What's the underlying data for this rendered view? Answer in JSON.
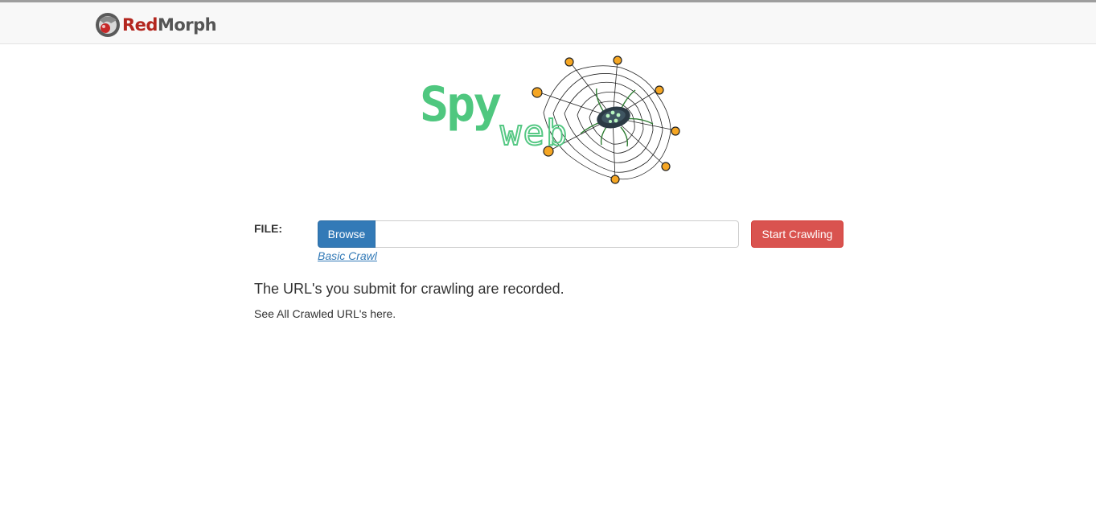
{
  "navbar": {
    "brand_part1": "Red",
    "brand_part2": "Morph",
    "brand_icon": "redmorph-logo-icon",
    "colors": {
      "background": "#f8f8f8",
      "brand_red": "#b3261e",
      "brand_gray": "#555555"
    }
  },
  "hero": {
    "logo_text_1": "Spy",
    "logo_text_2": "web",
    "logo_icon": "spider-web-icon",
    "colors": {
      "text_green": "#4fc77f",
      "bead_orange": "#f5a623"
    }
  },
  "form": {
    "file_label": "FILE:",
    "browse_label": "Browse",
    "file_value": "",
    "start_label": "Start Crawling",
    "basic_crawl_link": "Basic Crawl",
    "colors": {
      "browse": "#337ab7",
      "start": "#d9534f",
      "link": "#337ab7"
    }
  },
  "info": {
    "heading": "The URL's you submit for crawling are recorded.",
    "subtext": "See All Crawled URL's here."
  }
}
